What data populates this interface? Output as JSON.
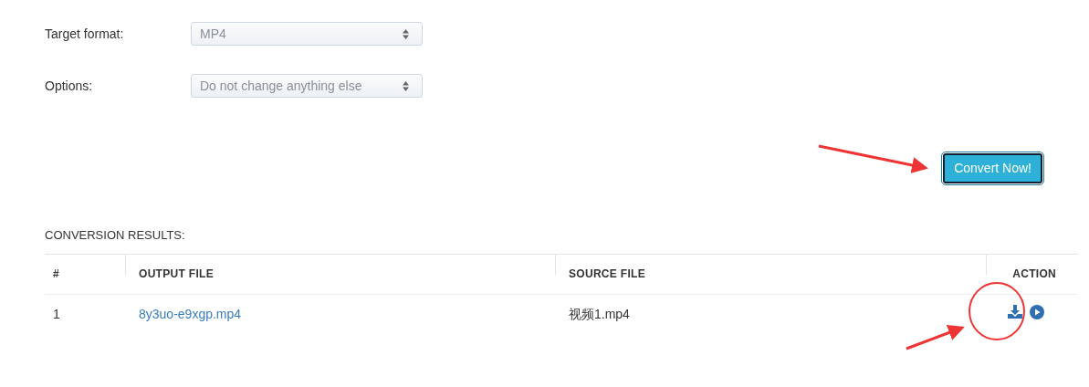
{
  "form": {
    "fields": [
      {
        "label": "Target format:",
        "value": "MP4"
      },
      {
        "label": "Options:",
        "value": "Do not change anything else"
      }
    ],
    "submit_button": "Convert Now!"
  },
  "results": {
    "heading": "CONVERSION RESULTS:",
    "columns": [
      "#",
      "OUTPUT FILE",
      "SOURCE FILE",
      "ACTION"
    ],
    "rows": [
      {
        "index": "1",
        "output_file": "8y3uo-e9xgp.mp4",
        "source_file": "视频1.mp4"
      }
    ]
  }
}
